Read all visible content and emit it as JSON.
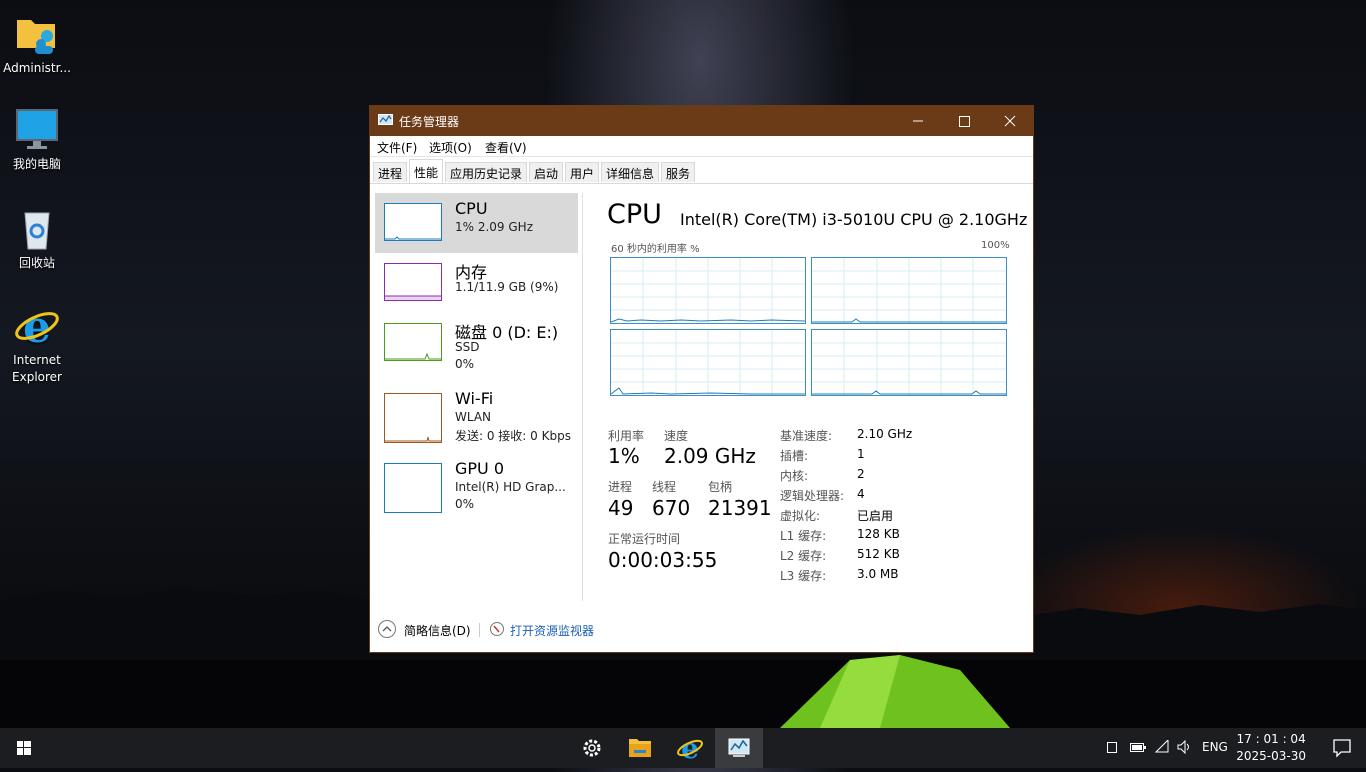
{
  "desktop": {
    "icons": [
      {
        "label": "Administr...",
        "icon": "user-folder-icon"
      },
      {
        "label": "我的电脑",
        "icon": "computer-icon"
      },
      {
        "label": "回收站",
        "icon": "recycle-bin-icon"
      },
      {
        "label": "Internet Explorer",
        "icon": "internet-explorer-icon"
      }
    ]
  },
  "window": {
    "title": "任务管理器",
    "menu": [
      "文件(F)",
      "选项(O)",
      "查看(V)"
    ],
    "tabs": [
      "进程",
      "性能",
      "应用历史记录",
      "启动",
      "用户",
      "详细信息",
      "服务"
    ],
    "active_tab": "性能",
    "titlebar_color": "#6b3a16"
  },
  "resources": [
    {
      "name": "CPU",
      "line2": "1% 2.09 GHz",
      "line3": "",
      "color": "#1f7bb8",
      "selected": true
    },
    {
      "name": "内存",
      "line2": "1.1/11.9 GB (9%)",
      "line3": "",
      "color": "#8b2bb0",
      "selected": false
    },
    {
      "name": "磁盘 0 (D: E:)",
      "line2": "SSD",
      "line3": "0%",
      "color": "#4c9a19",
      "selected": false
    },
    {
      "name": "Wi-Fi",
      "line2": "WLAN",
      "line3": "发送: 0 接收: 0 Kbps",
      "color": "#a0581e",
      "selected": false
    },
    {
      "name": "GPU 0",
      "line2": "Intel(R) HD Grap...",
      "line3": "0%",
      "color": "#1f7bb8",
      "selected": false
    }
  ],
  "cpu": {
    "title": "CPU",
    "model": "Intel(R) Core(TM) i3-5010U CPU @ 2.10GHz",
    "graph_label": "60 秒内的利用率 %",
    "graph_max": "100%",
    "stats": {
      "util_label": "利用率",
      "util_value": "1%",
      "speed_label": "速度",
      "speed_value": "2.09 GHz",
      "proc_label": "进程",
      "proc_value": "49",
      "thread_label": "线程",
      "thread_value": "670",
      "handle_label": "包柄",
      "handle_value": "21391",
      "uptime_label": "正常运行时间",
      "uptime_value": "0:00:03:55"
    },
    "details": [
      {
        "k": "基准速度:",
        "v": "2.10 GHz"
      },
      {
        "k": "插槽:",
        "v": "1"
      },
      {
        "k": "内核:",
        "v": "2"
      },
      {
        "k": "逻辑处理器:",
        "v": "4"
      },
      {
        "k": "虚拟化:",
        "v": "已启用"
      },
      {
        "k": "L1 缓存:",
        "v": "128 KB"
      },
      {
        "k": "L2 缓存:",
        "v": "512 KB"
      },
      {
        "k": "L3 缓存:",
        "v": "3.0 MB"
      }
    ]
  },
  "footer": {
    "less_label": "简略信息(D)",
    "monitor_link": "打开资源监视器"
  },
  "taskbar": {
    "apps": [
      "settings-icon",
      "file-explorer-icon",
      "internet-explorer-icon",
      "task-manager-icon"
    ],
    "tray_lang": "ENG",
    "time": "17 : 01 : 04",
    "date": "2025-03-30"
  }
}
